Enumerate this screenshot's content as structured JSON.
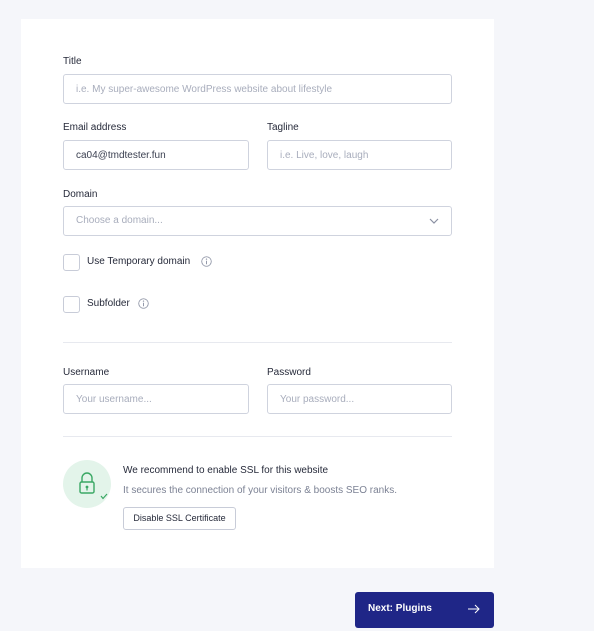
{
  "form": {
    "title": {
      "label": "Title",
      "placeholder": "i.e. My super-awesome WordPress website about lifestyle"
    },
    "email": {
      "label": "Email address",
      "value": "ca04@tmdtester.fun"
    },
    "tagline": {
      "label": "Tagline",
      "placeholder": "i.e. Live, love, laugh"
    },
    "domain": {
      "label": "Domain",
      "placeholder": "Choose a domain..."
    },
    "temp_domain": {
      "label": "Use Temporary domain",
      "checked": false
    },
    "subfolder": {
      "label": "Subfolder",
      "checked": false
    },
    "username": {
      "label": "Username",
      "placeholder": "Your username..."
    },
    "password": {
      "label": "Password",
      "placeholder": "Your password..."
    }
  },
  "ssl": {
    "title": "We recommend to enable SSL for this website",
    "subtitle": "It secures the connection of your visitors & boosts SEO ranks.",
    "button_label": "Disable SSL Certificate",
    "icon": "lock-icon"
  },
  "footer": {
    "next_label": "Next: Plugins"
  },
  "colors": {
    "accent": "#1f2687",
    "ssl_bg": "#e3f4ea",
    "ssl_icon": "#3aa864"
  }
}
